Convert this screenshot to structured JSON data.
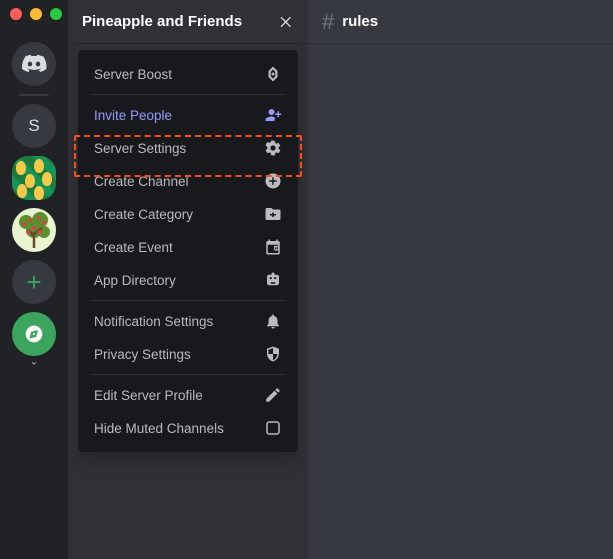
{
  "window": {
    "server_title": "Pineapple and Friends",
    "channel_name": "rules"
  },
  "guilds": {
    "initial": "S",
    "add_symbol": "+"
  },
  "menu": {
    "items": [
      {
        "id": "server-boost",
        "label": "Server Boost",
        "icon": "boost"
      },
      {
        "sep": true
      },
      {
        "id": "invite-people",
        "label": "Invite People",
        "icon": "invite",
        "brand": true
      },
      {
        "id": "server-settings",
        "label": "Server Settings",
        "icon": "gear"
      },
      {
        "id": "create-channel",
        "label": "Create Channel",
        "icon": "plus-circle"
      },
      {
        "id": "create-category",
        "label": "Create Category",
        "icon": "folder-plus"
      },
      {
        "id": "create-event",
        "label": "Create Event",
        "icon": "calendar"
      },
      {
        "id": "app-directory",
        "label": "App Directory",
        "icon": "robot"
      },
      {
        "sep": true
      },
      {
        "id": "notification-settings",
        "label": "Notification Settings",
        "icon": "bell"
      },
      {
        "id": "privacy-settings",
        "label": "Privacy Settings",
        "icon": "shield"
      },
      {
        "sep": true
      },
      {
        "id": "edit-server-profile",
        "label": "Edit Server Profile",
        "icon": "pencil"
      },
      {
        "id": "hide-muted",
        "label": "Hide Muted Channels",
        "icon": "checkbox"
      }
    ]
  },
  "colors": {
    "brand": "#949cf7",
    "highlight": "#ff4a1c",
    "green": "#3ba55d"
  }
}
